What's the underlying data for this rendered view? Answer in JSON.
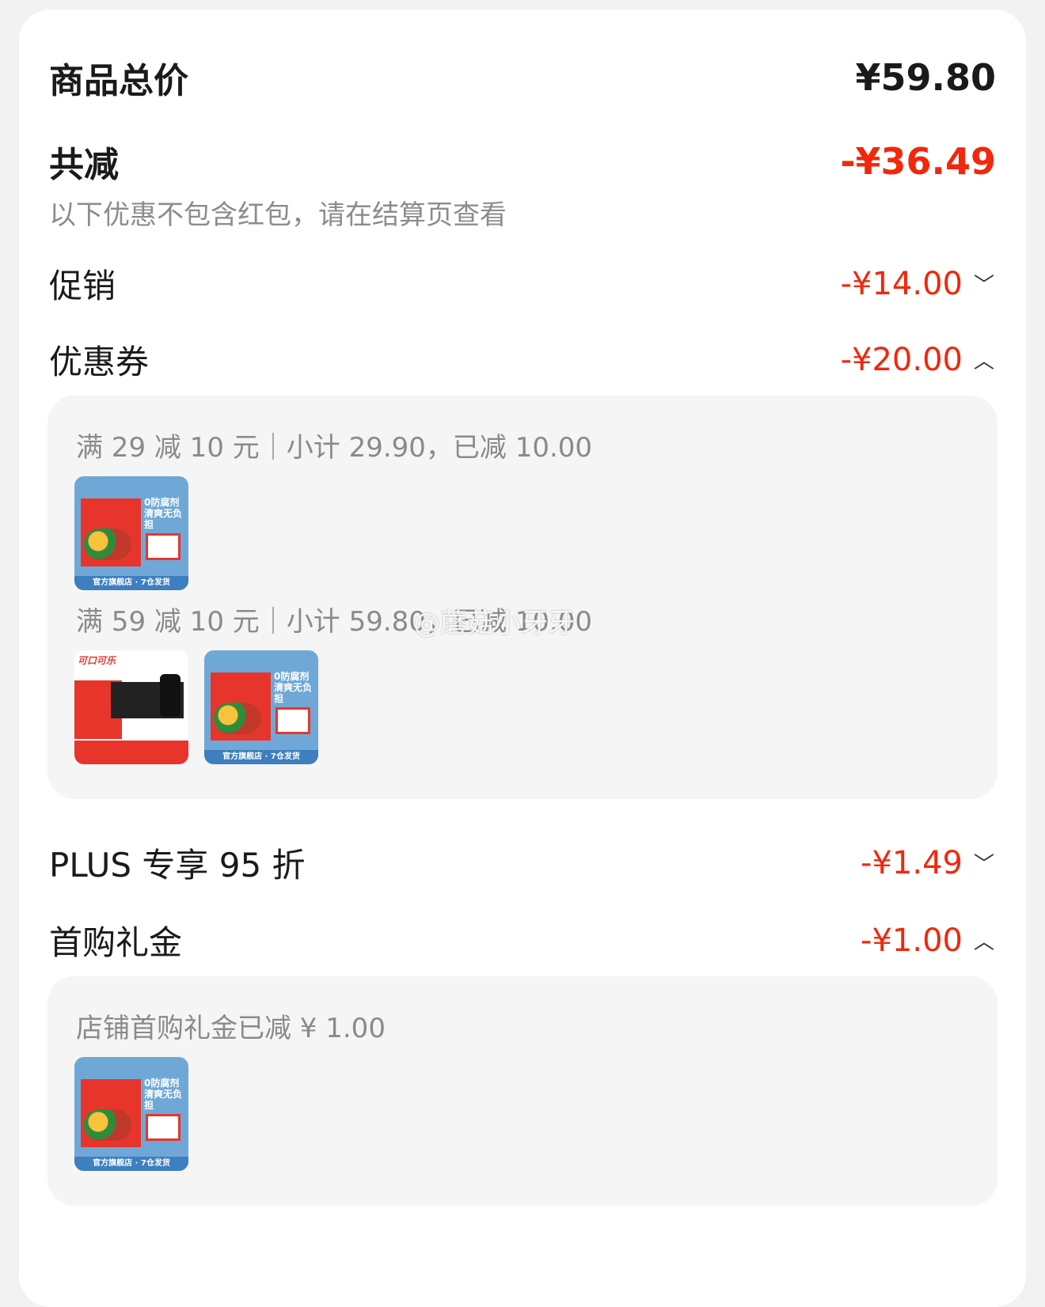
{
  "summary": {
    "total_label": "商品总价",
    "total_value": "¥59.80",
    "reduce_label": "共减",
    "reduce_value": "-¥36.49",
    "note": "以下优惠不包含红包，请在结算页查看"
  },
  "items": [
    {
      "label": "促销",
      "value": "-¥14.00",
      "chevron": "chevron-down-icon",
      "glyph": "﹀"
    },
    {
      "label": "优惠券",
      "value": "-¥20.00",
      "chevron": "chevron-up-icon",
      "glyph": "︿"
    },
    {
      "label": "PLUS 专享 95 折",
      "value": "-¥1.49",
      "chevron": "chevron-down-icon",
      "glyph": "﹀"
    },
    {
      "label": "首购礼金",
      "value": "-¥1.00",
      "chevron": "chevron-up-icon",
      "glyph": "︿"
    }
  ],
  "coupons": [
    {
      "rule": "满 29 减 10 元",
      "detail": "小计 29.90，已减 10.00"
    },
    {
      "rule": "满 59 减 10 元",
      "detail": "小计 59.80，已减 10.00"
    }
  ],
  "gift": {
    "text": "店铺首购礼金已减 ¥ 1.00"
  },
  "products": {
    "veg_band": "官方旗舰店 · 7仓发货",
    "veg_text": "0防腐剂 清爽无负担",
    "cola_logo": "可口可乐"
  },
  "watermark": "@蘑菇小牙牙",
  "colors": {
    "accent": "#f2270c",
    "panel": "#f5f5f5"
  }
}
